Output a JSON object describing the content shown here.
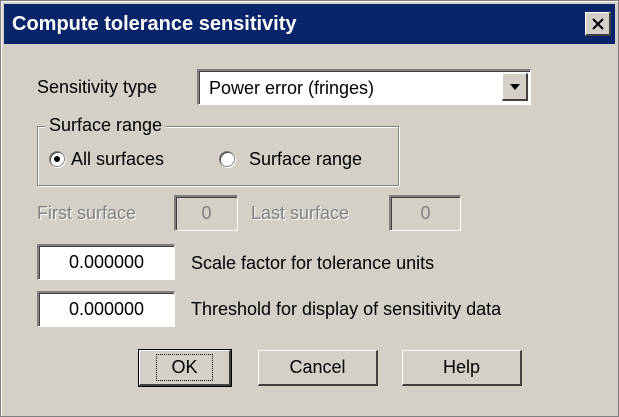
{
  "dialog": {
    "title": "Compute tolerance sensitivity",
    "sensitivity_type_label": "Sensitivity type",
    "sensitivity_type_value": "Power error (fringes)",
    "surface_range_group": "Surface range",
    "radio_all_surfaces": "All surfaces",
    "radio_surface_range": "Surface range",
    "selected_radio": "All surfaces",
    "first_surface_label": "First surface",
    "first_surface_value": "0",
    "last_surface_label": "Last surface",
    "last_surface_value": "0",
    "scale_factor_value": "0.000000",
    "scale_factor_label": "Scale factor for tolerance units",
    "threshold_value": "0.000000",
    "threshold_label": "Threshold for display of sensitivity data",
    "ok_label": "OK",
    "cancel_label": "Cancel",
    "help_label": "Help"
  },
  "colors": {
    "title_bar": "#0a246a",
    "dialog_bg": "#d4d0c8",
    "disabled_text": "#808080"
  },
  "icons": {
    "close": "close-icon",
    "dropdown": "chevron-down-icon"
  }
}
